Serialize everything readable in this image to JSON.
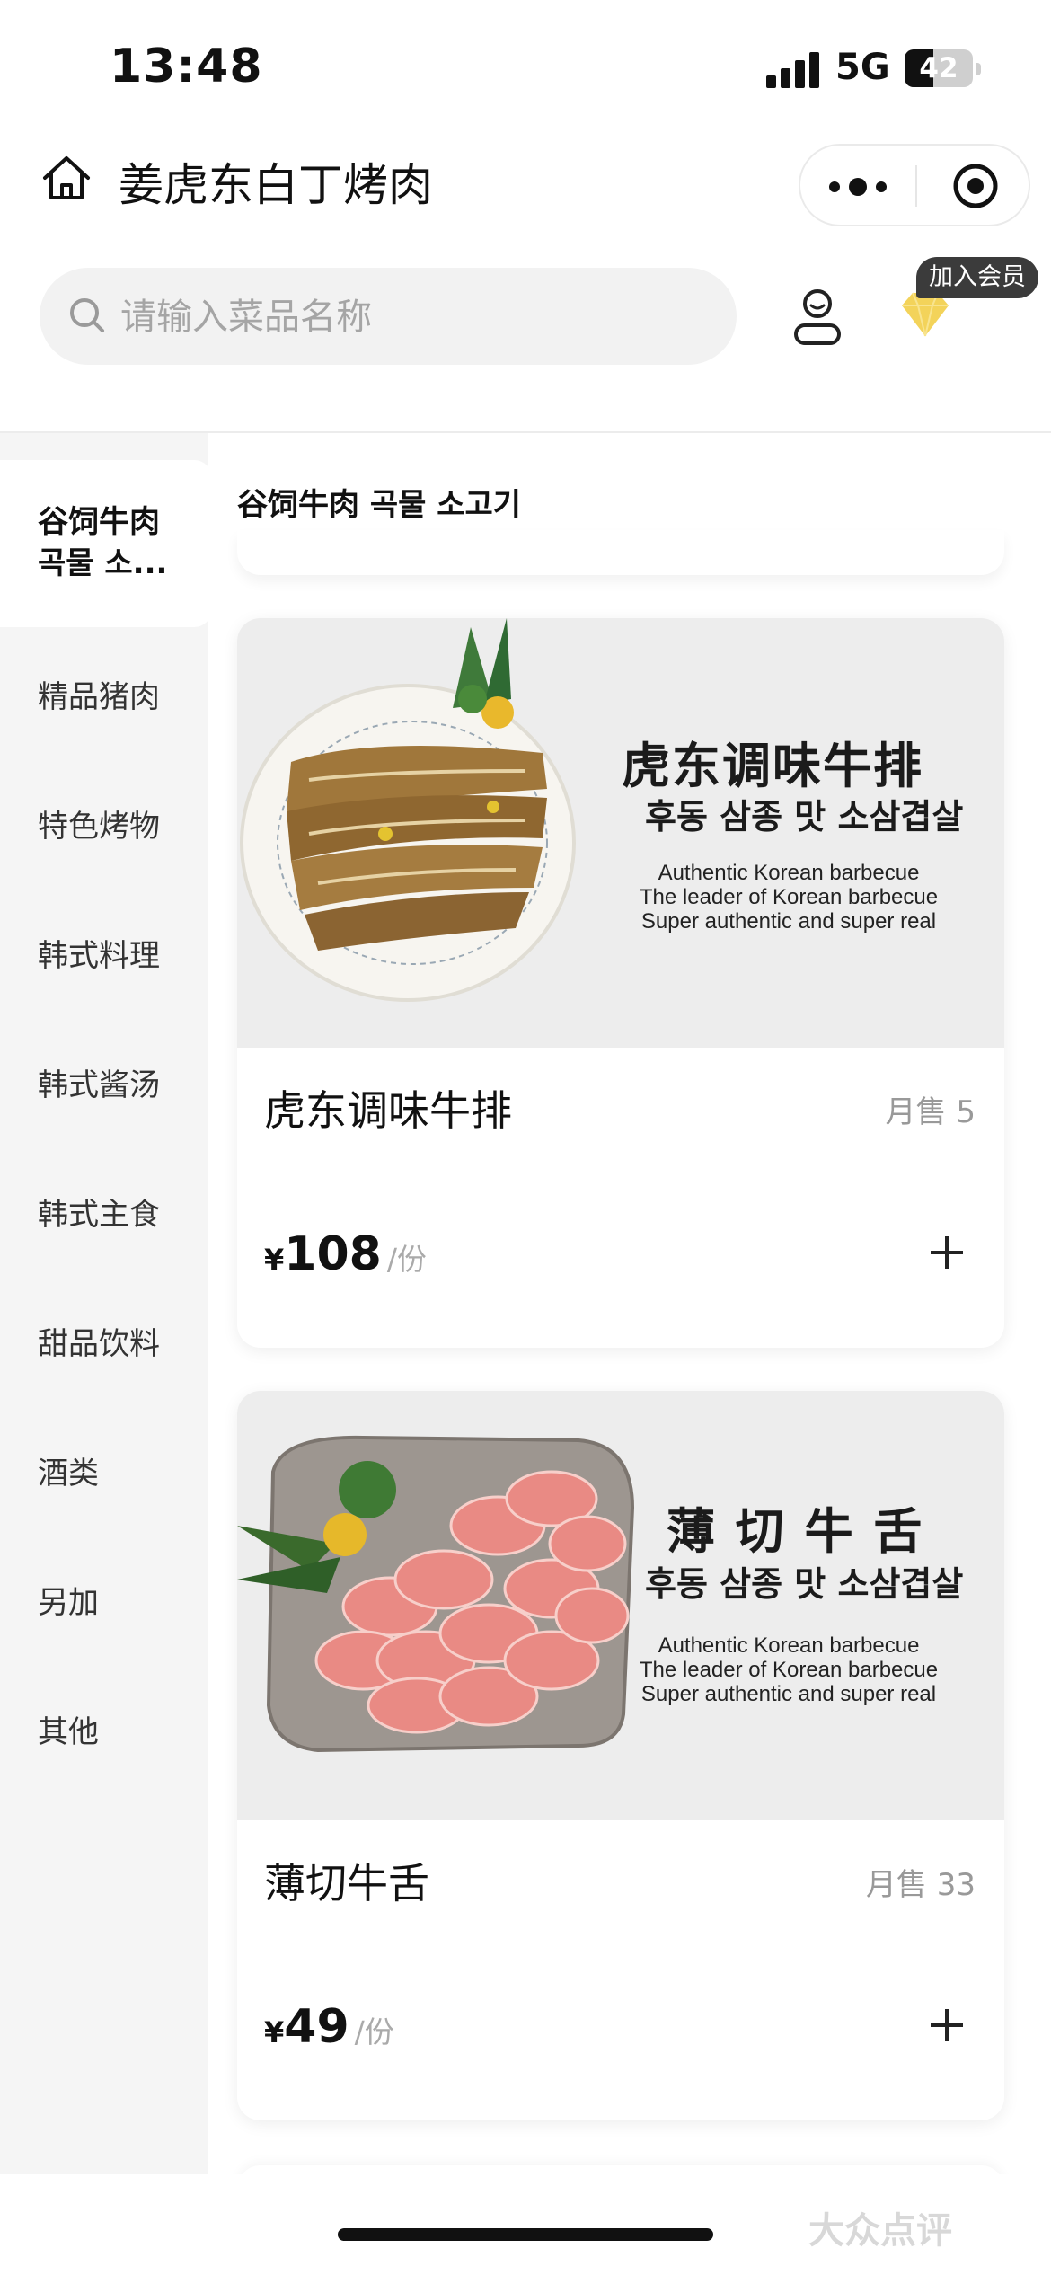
{
  "status_bar": {
    "time": "13:48",
    "network": "5G",
    "battery": "42",
    "battery_level": 0.42
  },
  "header": {
    "title": "姜虎东白丁烤肉"
  },
  "search": {
    "placeholder": "请输入菜品名称"
  },
  "member": {
    "badge": "加入会员"
  },
  "sidebar": {
    "active": "谷饲牛肉 곡물 소...",
    "items": [
      "精品猪肉",
      "特色烤物",
      "韩式料理",
      "韩式酱汤",
      "韩式主食",
      "甜品饮料",
      "酒类",
      "另加",
      "其他"
    ]
  },
  "section": {
    "title": "谷饲牛肉 곡물 소고기"
  },
  "products": [
    {
      "name": "虎东调味牛排",
      "sales": "月售 5",
      "currency": "¥",
      "price": "108",
      "unit": "/份",
      "image_title": "虎东调味牛排",
      "image_korean": "후동 삼종 맛 소삼겹살",
      "image_lines": [
        "Authentic Korean barbecue",
        "The leader of Korean barbecue",
        "Super authentic and super real"
      ]
    },
    {
      "name": "薄切牛舌",
      "sales": "月售 33",
      "currency": "¥",
      "price": "49",
      "unit": "/份",
      "image_title": "薄 切 牛 舌",
      "image_korean": "후동 삼종 맛 소삼겹살",
      "image_lines": [
        "Authentic Korean barbecue",
        "The leader of Korean barbecue",
        "Super authentic and super real"
      ]
    }
  ],
  "watermark": "大众点评",
  "colors": {
    "accent_gold": "#f3d35a",
    "badge_bg": "#3b3b3b",
    "sidebar_bg": "#f5f5f5"
  }
}
